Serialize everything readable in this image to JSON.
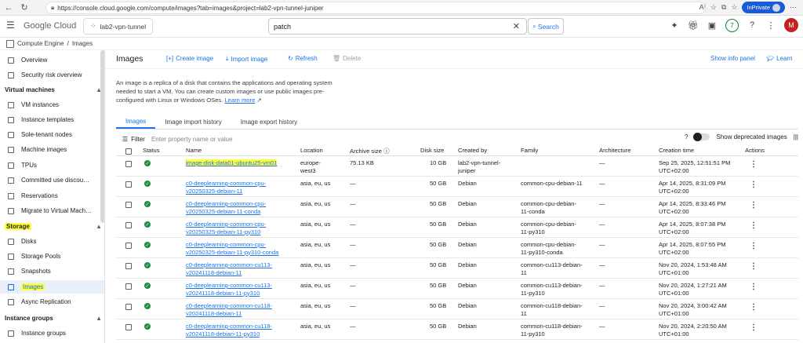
{
  "browser": {
    "url": "https://console.cloud.google.com/compute/images?tab=images&project=lab2-vpn-tunnel-juniper",
    "inprivate_label": "InPrivate"
  },
  "header": {
    "logo": "Google Cloud",
    "project": "lab2-vpn-tunnel",
    "search_value": "patch",
    "search_button": "Search",
    "notifications_count": "7",
    "user_initial": "M"
  },
  "breadcrumb": {
    "product": "Compute Engine",
    "separator": "/",
    "page": "Images"
  },
  "sidebar": {
    "items_top": [
      {
        "label": "Overview",
        "icon": "overview-icon"
      },
      {
        "label": "Security risk overview",
        "icon": "security-icon"
      }
    ],
    "sections": [
      {
        "title": "Virtual machines",
        "items": [
          "VM instances",
          "Instance templates",
          "Sole-tenant nodes",
          "Machine images",
          "TPUs",
          "Committed use discou…",
          "Reservations",
          "Migrate to Virtual Mach…"
        ]
      },
      {
        "title": "Storage",
        "items": [
          "Disks",
          "Storage Pools",
          "Snapshots",
          "Images",
          "Async Replication"
        ]
      },
      {
        "title": "Instance groups",
        "items": [
          "Instance groups"
        ]
      }
    ]
  },
  "toolbar": {
    "title": "Images",
    "create_image": "Create image",
    "import_image": "Import image",
    "refresh": "Refresh",
    "delete": "Delete",
    "show_info_panel": "Show info panel",
    "learn": "Learn"
  },
  "description": {
    "text": "An image is a replica of a disk that contains the applications and operating system needed to start a VM. You can create custom images or use public images pre-configured with Linux or Windows OSes.",
    "link": "Learn more"
  },
  "tabs": [
    "Images",
    "Image import history",
    "Image export history"
  ],
  "filter": {
    "label": "Filter",
    "placeholder": "Enter property name or value",
    "show_deprecated": "Show deprecated images"
  },
  "table": {
    "headers": [
      "Status",
      "Name",
      "Location",
      "Archive size",
      "Disk size",
      "Created by",
      "Family",
      "Architecture",
      "Creation time",
      "Actions"
    ],
    "rows": [
      {
        "name1": "image-disk-data01-ubuntu25-vm01",
        "name2": "",
        "loc1": "europe-",
        "loc2": "west3",
        "archive": "75.13 KB",
        "disk": "10 GB",
        "by1": "lab2-vpn-tunnel-",
        "by2": "juniper",
        "fam1": "",
        "fam2": "",
        "arch": "—",
        "t1": "Sep 25, 2025, 12:51:51 PM",
        "t2": "UTC+02:00"
      },
      {
        "name1": "c0-deeplearning-common-cpu-",
        "name2": "v20250325-debian-11",
        "loc1": "asia, eu, us",
        "loc2": "",
        "archive": "—",
        "disk": "50 GB",
        "by1": "Debian",
        "by2": "",
        "fam1": "common-cpu-debian-11",
        "fam2": "",
        "arch": "—",
        "t1": "Apr 14, 2025, 8:31:09 PM",
        "t2": "UTC+02:00"
      },
      {
        "name1": "c0-deeplearning-common-cpu-",
        "name2": "v20250325-debian-11-conda",
        "loc1": "asia, eu, us",
        "loc2": "",
        "archive": "—",
        "disk": "50 GB",
        "by1": "Debian",
        "by2": "",
        "fam1": "common-cpu-debian-",
        "fam2": "11-conda",
        "arch": "—",
        "t1": "Apr 14, 2025, 8:33:46 PM",
        "t2": "UTC+02:00"
      },
      {
        "name1": "c0-deeplearning-common-cpu-",
        "name2": "v20250325-debian-11-py310",
        "loc1": "asia, eu, us",
        "loc2": "",
        "archive": "—",
        "disk": "50 GB",
        "by1": "Debian",
        "by2": "",
        "fam1": "common-cpu-debian-",
        "fam2": "11-py310",
        "arch": "—",
        "t1": "Apr 14, 2025, 8:07:38 PM",
        "t2": "UTC+02:00"
      },
      {
        "name1": "c0-deeplearning-common-cpu-",
        "name2": "v20250325-debian-11-py310-conda",
        "loc1": "asia, eu, us",
        "loc2": "",
        "archive": "—",
        "disk": "50 GB",
        "by1": "Debian",
        "by2": "",
        "fam1": "common-cpu-debian-",
        "fam2": "11-py310-conda",
        "arch": "—",
        "t1": "Apr 14, 2025, 8:07:55 PM",
        "t2": "UTC+02:00"
      },
      {
        "name1": "c0-deeplearning-common-cu113-",
        "name2": "v20241118-debian-11",
        "loc1": "asia, eu, us",
        "loc2": "",
        "archive": "—",
        "disk": "50 GB",
        "by1": "Debian",
        "by2": "",
        "fam1": "common-cu113-debian-",
        "fam2": "11",
        "arch": "—",
        "t1": "Nov 20, 2024, 1:53:48 AM",
        "t2": "UTC+01:00"
      },
      {
        "name1": "c0-deeplearning-common-cu113-",
        "name2": "v20241118-debian-11-py310",
        "loc1": "asia, eu, us",
        "loc2": "",
        "archive": "—",
        "disk": "50 GB",
        "by1": "Debian",
        "by2": "",
        "fam1": "common-cu113-debian-",
        "fam2": "11-py310",
        "arch": "—",
        "t1": "Nov 20, 2024, 1:27:21 AM",
        "t2": "UTC+01:00"
      },
      {
        "name1": "c0-deeplearning-common-cu118-",
        "name2": "v20241118-debian-11",
        "loc1": "asia, eu, us",
        "loc2": "",
        "archive": "—",
        "disk": "50 GB",
        "by1": "Debian",
        "by2": "",
        "fam1": "common-cu118-debian-",
        "fam2": "11",
        "arch": "—",
        "t1": "Nov 20, 2024, 3:00:42 AM",
        "t2": "UTC+01:00"
      },
      {
        "name1": "c0-deeplearning-common-cu118-",
        "name2": "v20241118-debian-11-py310",
        "loc1": "asia, eu, us",
        "loc2": "",
        "archive": "—",
        "disk": "50 GB",
        "by1": "Debian",
        "by2": "",
        "fam1": "common-cu118-debian-",
        "fam2": "11-py310",
        "arch": "—",
        "t1": "Nov 20, 2024, 2:20:50 AM",
        "t2": "UTC+01:00"
      }
    ]
  },
  "colors": {
    "accent": "#1a73e8",
    "status_ok": "#1e8e3e",
    "highlight": "#ffff3a",
    "active_nav_bg": "#e8f0fe"
  }
}
